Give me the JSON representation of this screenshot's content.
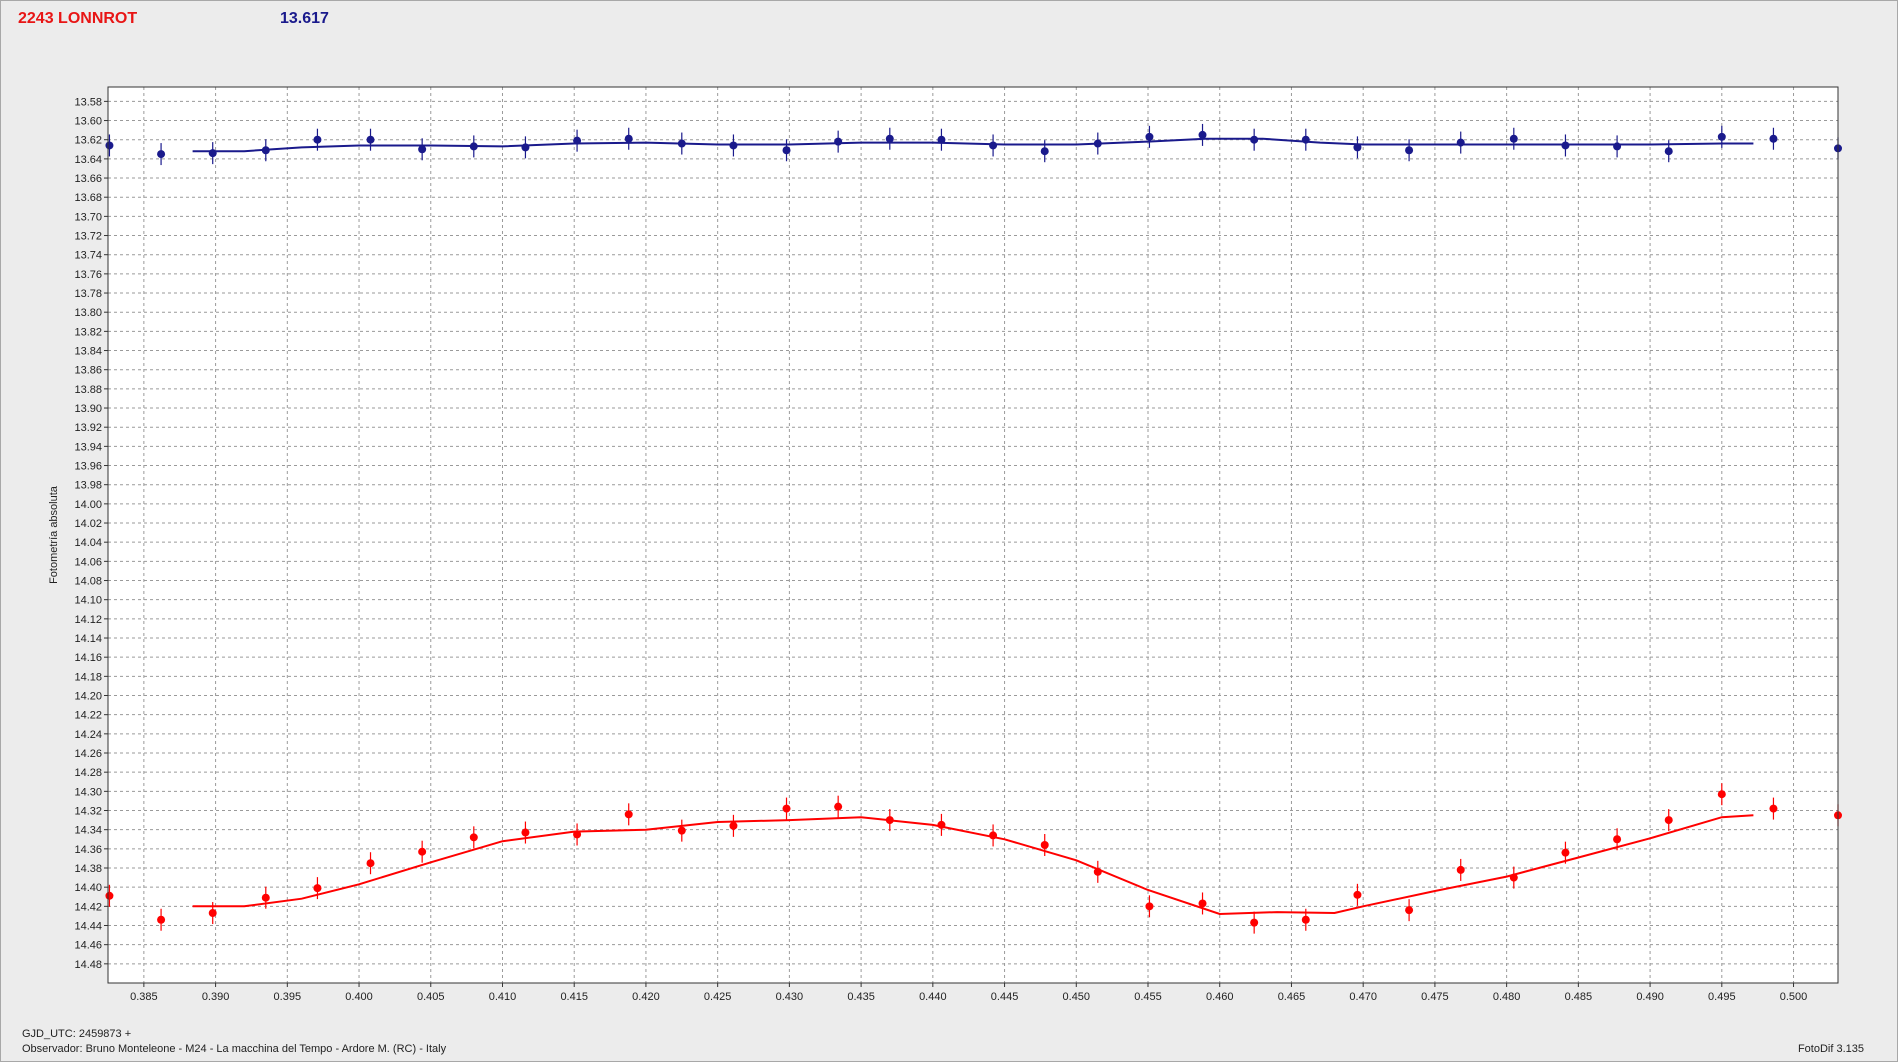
{
  "header": {
    "object_name": "2243 LONNROT",
    "magnitude": "13.617"
  },
  "footer": {
    "gjd": "GJD_UTC: 2459873 +",
    "observer": "Observador: Bruno Monteleone - M24 - La macchina del Tempo - Ardore M. (RC) - Italy",
    "software": "FotoDif 3.135"
  },
  "colors": {
    "comparison": "#1a1a8c",
    "target": "#ff0000",
    "grid": "#9a9a9a",
    "background": "#ffffff",
    "page": "#ececec"
  },
  "chart_data": {
    "type": "scatter",
    "title": "",
    "xlabel": "",
    "ylabel": "Fotometría absoluta",
    "xlim": [
      0.3825,
      0.5031
    ],
    "ylim": [
      13.565,
      14.5
    ],
    "y_inverted": true,
    "x_ticks": [
      "0.385",
      "0.390",
      "0.395",
      "0.400",
      "0.405",
      "0.410",
      "0.415",
      "0.420",
      "0.425",
      "0.430",
      "0.435",
      "0.440",
      "0.445",
      "0.450",
      "0.455",
      "0.460",
      "0.465",
      "0.470",
      "0.475",
      "0.480",
      "0.485",
      "0.490",
      "0.495",
      "0.500"
    ],
    "y_ticks": [
      "13.58",
      "13.60",
      "13.62",
      "13.64",
      "13.66",
      "13.68",
      "13.70",
      "13.72",
      "13.74",
      "13.76",
      "13.78",
      "13.80",
      "13.82",
      "13.84",
      "13.86",
      "13.88",
      "13.90",
      "13.92",
      "13.94",
      "13.96",
      "13.98",
      "14.00",
      "14.02",
      "14.04",
      "14.06",
      "14.08",
      "14.10",
      "14.12",
      "14.14",
      "14.16",
      "14.18",
      "14.20",
      "14.22",
      "14.24",
      "14.26",
      "14.28",
      "14.30",
      "14.32",
      "14.34",
      "14.36",
      "14.38",
      "14.40",
      "14.42",
      "14.44",
      "14.46",
      "14.48"
    ],
    "grid": true,
    "series": [
      {
        "color": "#1a1a8c",
        "x": [
          0.3826,
          0.3862,
          0.3898,
          0.3935,
          0.3971,
          0.4008,
          0.4044,
          0.408,
          0.4116,
          0.4152,
          0.4188,
          0.4225,
          0.4261,
          0.4298,
          0.4334,
          0.437,
          0.4406,
          0.4442,
          0.4478,
          0.4515,
          0.4551,
          0.4588,
          0.4624,
          0.466,
          0.4696,
          0.4732,
          0.4768,
          0.4805,
          0.4841,
          0.4877,
          0.4913,
          0.495,
          0.4986,
          0.5031
        ],
        "y": [
          13.626,
          13.635,
          13.634,
          13.631,
          13.62,
          13.62,
          13.63,
          13.627,
          13.628,
          13.621,
          13.619,
          13.624,
          13.626,
          13.631,
          13.622,
          13.619,
          13.62,
          13.626,
          13.632,
          13.624,
          13.617,
          13.615,
          13.62,
          13.62,
          13.628,
          13.631,
          13.623,
          13.619,
          13.626,
          13.627,
          13.632,
          13.617,
          13.619,
          13.629
        ],
        "fit_x": [
          0.3884,
          0.392,
          0.396,
          0.4,
          0.405,
          0.41,
          0.415,
          0.42,
          0.425,
          0.43,
          0.435,
          0.44,
          0.445,
          0.45,
          0.455,
          0.459,
          0.463,
          0.467,
          0.47,
          0.475,
          0.48,
          0.485,
          0.49,
          0.495,
          0.4972
        ],
        "fit_y": [
          13.632,
          13.632,
          13.628,
          13.626,
          13.626,
          13.627,
          13.624,
          13.623,
          13.625,
          13.625,
          13.623,
          13.623,
          13.625,
          13.625,
          13.622,
          13.619,
          13.619,
          13.623,
          13.625,
          13.625,
          13.625,
          13.625,
          13.625,
          13.624,
          13.624
        ]
      },
      {
        "color": "#ff0000",
        "x": [
          0.3826,
          0.3862,
          0.3898,
          0.3935,
          0.3971,
          0.4008,
          0.4044,
          0.408,
          0.4116,
          0.4152,
          0.4188,
          0.4225,
          0.4261,
          0.4298,
          0.4334,
          0.437,
          0.4406,
          0.4442,
          0.4478,
          0.4515,
          0.4551,
          0.4588,
          0.4624,
          0.466,
          0.4696,
          0.4732,
          0.4768,
          0.4805,
          0.4841,
          0.4877,
          0.4913,
          0.495,
          0.4986,
          0.5031
        ],
        "y": [
          14.409,
          14.434,
          14.427,
          14.411,
          14.401,
          14.375,
          14.363,
          14.348,
          14.343,
          14.345,
          14.324,
          14.341,
          14.336,
          14.318,
          14.316,
          14.33,
          14.335,
          14.346,
          14.356,
          14.384,
          14.42,
          14.417,
          14.437,
          14.434,
          14.408,
          14.424,
          14.382,
          14.39,
          14.364,
          14.35,
          14.33,
          14.303,
          14.318,
          14.325
        ],
        "fit_x": [
          0.3884,
          0.392,
          0.396,
          0.4,
          0.405,
          0.41,
          0.415,
          0.42,
          0.425,
          0.43,
          0.435,
          0.44,
          0.445,
          0.45,
          0.455,
          0.46,
          0.464,
          0.468,
          0.47,
          0.475,
          0.48,
          0.485,
          0.49,
          0.495,
          0.4972
        ],
        "fit_y": [
          14.42,
          14.42,
          14.412,
          14.397,
          14.374,
          14.352,
          14.342,
          14.34,
          14.332,
          14.33,
          14.327,
          14.335,
          14.35,
          14.372,
          14.403,
          14.428,
          14.426,
          14.427,
          14.42,
          14.404,
          14.389,
          14.369,
          14.349,
          14.327,
          14.325
        ]
      }
    ]
  }
}
